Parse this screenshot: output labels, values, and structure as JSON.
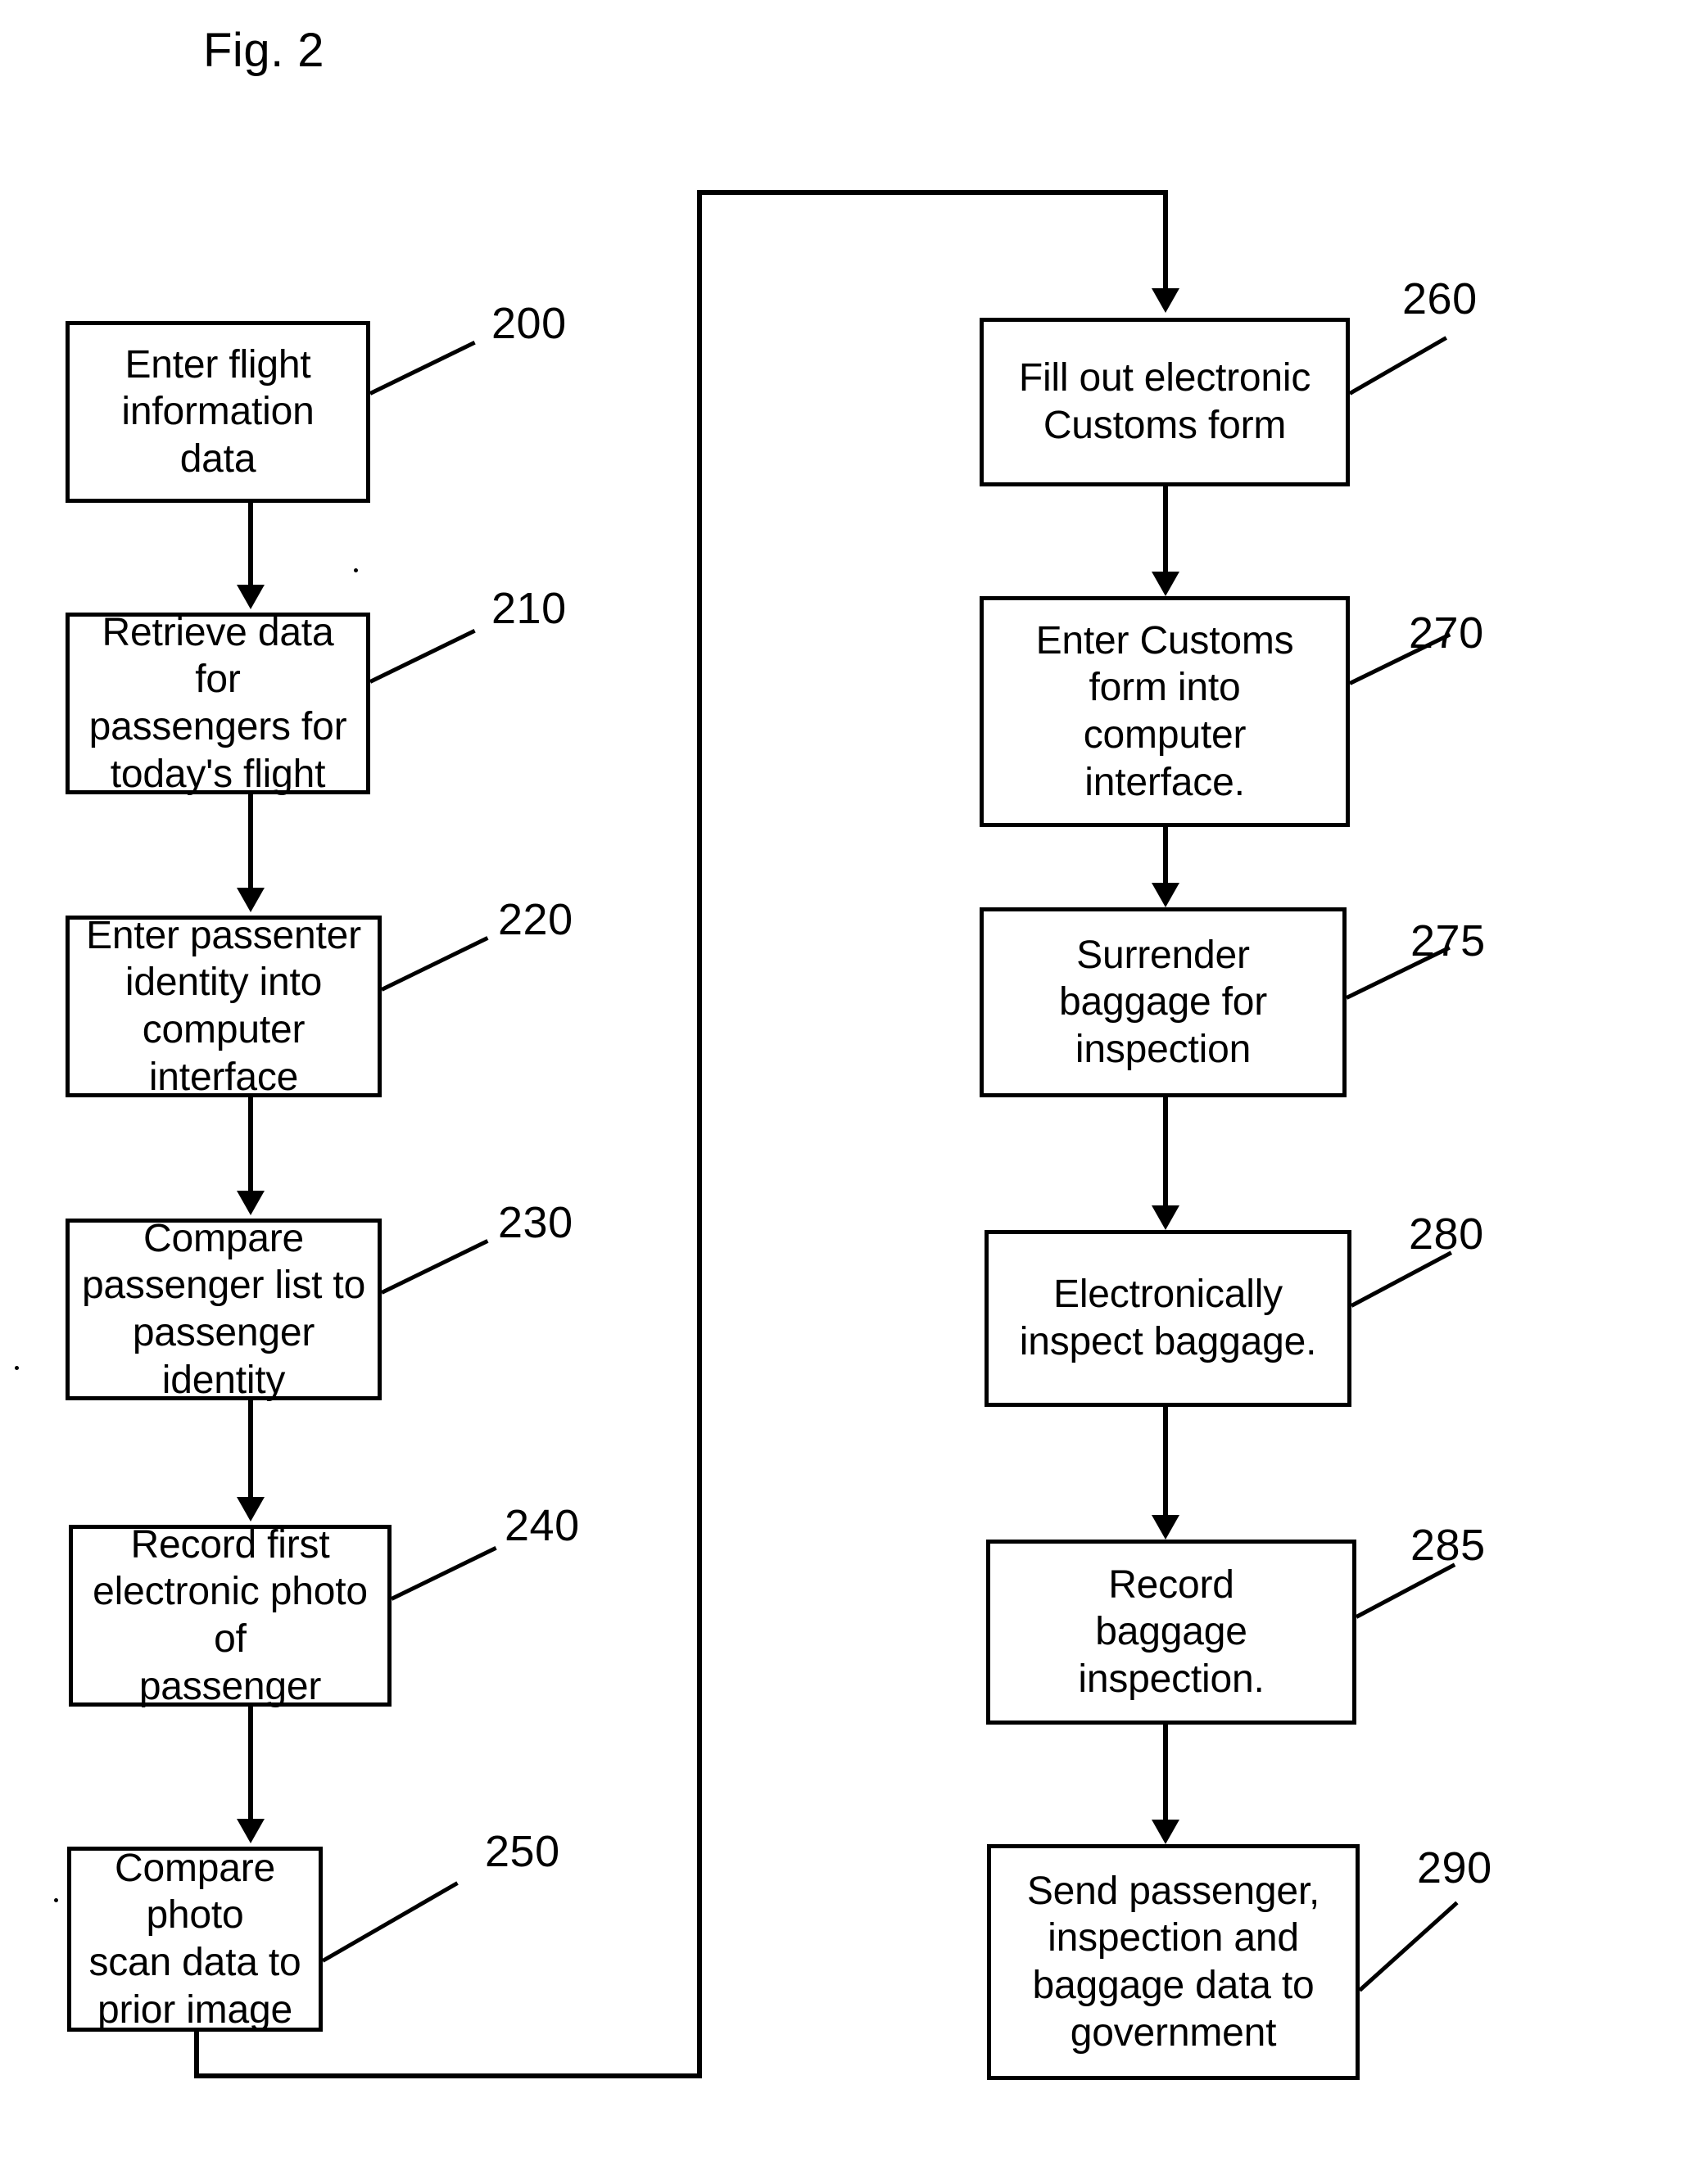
{
  "figure": {
    "title": "Fig. 2"
  },
  "flowchart": {
    "type": "flowchart",
    "orientation": "two-column top-to-bottom, left column feeds right column",
    "left_column": [
      {
        "ref": "200",
        "label": "Enter flight\ninformation data"
      },
      {
        "ref": "210",
        "label": "Retrieve data for\npassengers for\ntoday's flight"
      },
      {
        "ref": "220",
        "label": "Enter passenter\nidentity into\ncomputer interface"
      },
      {
        "ref": "230",
        "label": "Compare\npassenger list to\npassenger identity"
      },
      {
        "ref": "240",
        "label": "Record first\nelectronic photo of\npassenger"
      },
      {
        "ref": "250",
        "label": "Compare photo\nscan data to\nprior image"
      }
    ],
    "right_column": [
      {
        "ref": "260",
        "label": "Fill out electronic\nCustoms form"
      },
      {
        "ref": "270",
        "label": "Enter Customs\nform into\ncomputer\ninterface."
      },
      {
        "ref": "275",
        "label": "Surrender\nbaggage for\ninspection"
      },
      {
        "ref": "280",
        "label": "Electronically\ninspect baggage."
      },
      {
        "ref": "285",
        "label": "Record\nbaggage\ninspection."
      },
      {
        "ref": "290",
        "label": "Send passenger,\ninspection and\nbaggage data to\ngovernment"
      }
    ],
    "connections": [
      {
        "from": "200",
        "to": "210",
        "kind": "arrow-down"
      },
      {
        "from": "210",
        "to": "220",
        "kind": "arrow-down"
      },
      {
        "from": "220",
        "to": "230",
        "kind": "arrow-down"
      },
      {
        "from": "230",
        "to": "240",
        "kind": "arrow-down"
      },
      {
        "from": "240",
        "to": "250",
        "kind": "arrow-down"
      },
      {
        "from": "250",
        "to": "260",
        "kind": "routed-wrap-around"
      },
      {
        "from": "260",
        "to": "270",
        "kind": "arrow-down"
      },
      {
        "from": "270",
        "to": "275",
        "kind": "arrow-down"
      },
      {
        "from": "275",
        "to": "280",
        "kind": "arrow-down"
      },
      {
        "from": "280",
        "to": "285",
        "kind": "arrow-down"
      },
      {
        "from": "285",
        "to": "290",
        "kind": "arrow-down"
      }
    ]
  },
  "colors": {
    "ink": "#000000",
    "paper": "#ffffff"
  }
}
